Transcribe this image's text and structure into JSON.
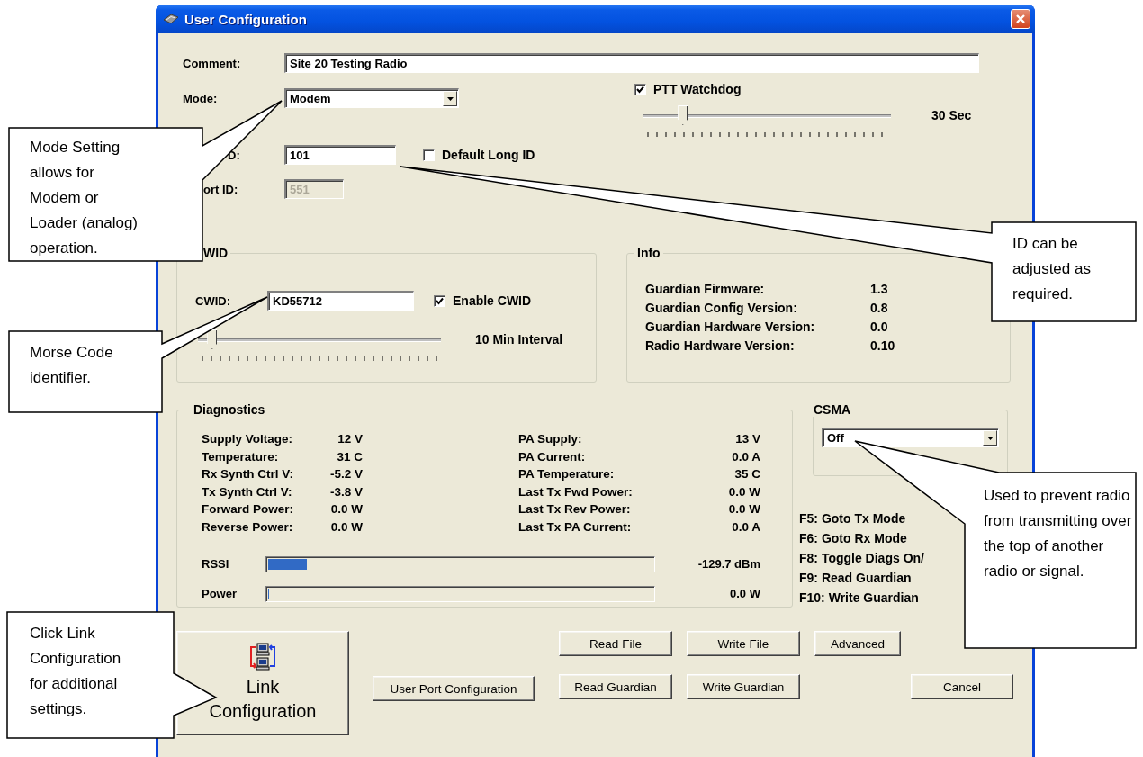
{
  "window": {
    "title": "User Configuration"
  },
  "comment": {
    "label": "Comment:",
    "value": "Site 20 Testing Radio"
  },
  "mode": {
    "label": "Mode:",
    "value": "Modem"
  },
  "ptt_watchdog": {
    "label": "PTT Watchdog",
    "checked": true,
    "level": 0.145,
    "reading": "30 Sec"
  },
  "long_id": {
    "label": "D:",
    "value": "101"
  },
  "default_long_id": {
    "label": "Default Long ID",
    "checked": false
  },
  "port_id": {
    "label": "ort ID:",
    "value": "551",
    "disabled": true
  },
  "cwid": {
    "title": "WID",
    "label": "CWID:",
    "value": "KD55712",
    "enable_label": "Enable CWID",
    "enabled": true,
    "level": 0.04,
    "reading": "10 Min Interval"
  },
  "info": {
    "title": "Info",
    "rows": [
      {
        "label": "Guardian Firmware:",
        "value": "1.3"
      },
      {
        "label": "Guardian Config Version:",
        "value": "0.8"
      },
      {
        "label": "Guardian Hardware Version:",
        "value": "0.0"
      },
      {
        "label": "Radio Hardware Version:",
        "value": "0.10"
      }
    ]
  },
  "diagnostics": {
    "title": "Diagnostics",
    "rows": [
      {
        "label": "Supply Voltage:",
        "value": "12 V",
        "label_2": "PA Supply:",
        "value_2": "13 V"
      },
      {
        "label": "Temperature:",
        "value": "31 C",
        "label_2": "PA Current:",
        "value_2": "0.0 A"
      },
      {
        "label": "Rx Synth Ctrl V:",
        "value": "-5.2 V",
        "label_2": "PA Temperature:",
        "value_2": "35 C"
      },
      {
        "label": "Tx Synth Ctrl V:",
        "value": "-3.8 V",
        "label_2": "Last Tx Fwd Power:",
        "value_2": "0.0 W"
      },
      {
        "label": "Forward Power:",
        "value": "0.0 W",
        "label_2": "Last Tx Rev Power:",
        "value_2": "0.0 W"
      },
      {
        "label": "Reverse Power:",
        "value": "0.0 W",
        "label_2": "Last Tx PA Current:",
        "value_2": "0.0 A"
      }
    ],
    "meters": [
      {
        "label": "RSSI",
        "level": 0.1,
        "reading": "-129.7 dBm"
      },
      {
        "label": "Power",
        "level": 0,
        "reading": "0.0 W"
      }
    ]
  },
  "csma": {
    "title": "CSMA",
    "value": "Off"
  },
  "shortcuts": [
    "F5: Goto Tx Mode",
    "F6: Goto Rx Mode",
    "F8: Toggle Diags On/",
    "F9: Read Guardian",
    "F10: Write Guardian"
  ],
  "link_button": {
    "label": "Link Configuration"
  },
  "user_port_button": {
    "label": "User Port Configuration"
  },
  "action_rows": [
    [
      {
        "label": "Read File"
      },
      {
        "label": "Write File"
      },
      {
        "label": "Advanced"
      }
    ],
    [
      {
        "label": "Read Guardian"
      },
      {
        "label": "Write Guardian"
      }
    ]
  ],
  "cancel_button": {
    "label": "Cancel"
  },
  "callouts": [
    {
      "text": "Mode Setting allows for Modem or Loader (analog) operation."
    },
    {
      "text": "ID can be adjusted as required."
    },
    {
      "text": "Morse Code identifier."
    },
    {
      "text": "Used to prevent radio from transmitting over the top of another radio or signal."
    },
    {
      "text": "Click Link Configuration for additional settings."
    }
  ]
}
